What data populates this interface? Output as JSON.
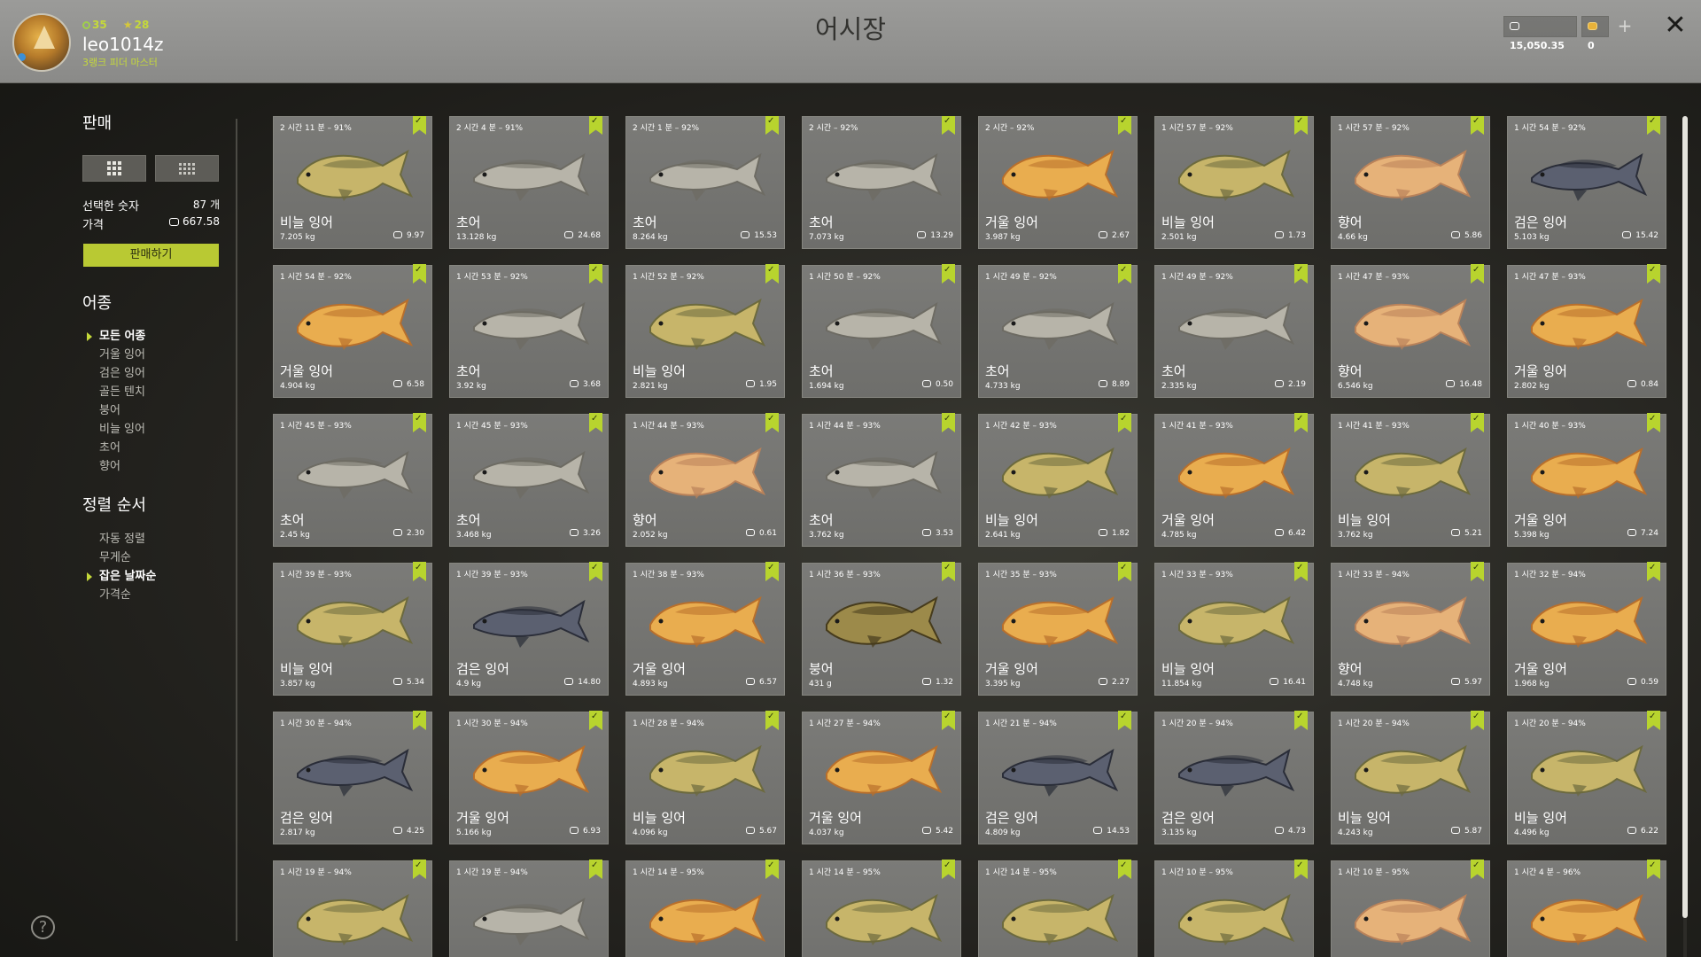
{
  "header": {
    "title": "어시장",
    "user": {
      "name": "leo1014z",
      "level": "35",
      "stars": "28",
      "rank": "3랭크 피더 마스터"
    },
    "silver": "15,050.35",
    "gold": "0",
    "plus_label": "+",
    "close_label": "✕"
  },
  "sidebar": {
    "sell_title": "판매",
    "selected_count_label": "선택한 숫자",
    "selected_count": "87 개",
    "price_label": "가격",
    "price_value": "667.58",
    "sell_button": "판매하기",
    "species_title": "어종",
    "species": [
      "모든 어종",
      "거울 잉어",
      "검은 잉어",
      "골든 텐치",
      "붕어",
      "비늘 잉어",
      "초어",
      "향어"
    ],
    "species_active": 0,
    "sort_title": "정렬 순서",
    "sort": [
      "자동 정렬",
      "무게순",
      "잡은 날짜순",
      "가격순"
    ],
    "sort_active": 2,
    "help_label": "?"
  },
  "colors": {
    "accent": "#b8d42e",
    "header_bg": "#929290",
    "card_bg": "#767673"
  },
  "fish_colors": {
    "비늘 잉어": [
      "#c7b56a",
      "#6c6a3e"
    ],
    "초어": [
      "#b7b4a9",
      "#6d6b63"
    ],
    "거울 잉어": [
      "#e9ad4f",
      "#b86f2c"
    ],
    "향어": [
      "#e6b279",
      "#b9825a"
    ],
    "검은 잉어": [
      "#5b6070",
      "#2a2d38"
    ],
    "붕어": [
      "#9c8a4a",
      "#463b1c"
    ]
  },
  "catches": [
    {
      "time": "2 시간 11 분 – 91%",
      "name": "비늘 잉어",
      "weight": "7.205 kg",
      "price": "9.97"
    },
    {
      "time": "2 시간 4 분 – 91%",
      "name": "초어",
      "weight": "13.128 kg",
      "price": "24.68"
    },
    {
      "time": "2 시간 1 분 – 92%",
      "name": "초어",
      "weight": "8.264 kg",
      "price": "15.53"
    },
    {
      "time": "2 시간 – 92%",
      "name": "초어",
      "weight": "7.073 kg",
      "price": "13.29"
    },
    {
      "time": "2 시간 – 92%",
      "name": "거울 잉어",
      "weight": "3.987 kg",
      "price": "2.67"
    },
    {
      "time": "1 시간 57 분 – 92%",
      "name": "비늘 잉어",
      "weight": "2.501 kg",
      "price": "1.73"
    },
    {
      "time": "1 시간 57 분 – 92%",
      "name": "향어",
      "weight": "4.66 kg",
      "price": "5.86"
    },
    {
      "time": "1 시간 54 분 – 92%",
      "name": "검은 잉어",
      "weight": "5.103 kg",
      "price": "15.42"
    },
    {
      "time": "1 시간 54 분 – 92%",
      "name": "거울 잉어",
      "weight": "4.904 kg",
      "price": "6.58"
    },
    {
      "time": "1 시간 53 분 – 92%",
      "name": "초어",
      "weight": "3.92 kg",
      "price": "3.68"
    },
    {
      "time": "1 시간 52 분 – 92%",
      "name": "비늘 잉어",
      "weight": "2.821 kg",
      "price": "1.95"
    },
    {
      "time": "1 시간 50 분 – 92%",
      "name": "초어",
      "weight": "1.694 kg",
      "price": "0.50"
    },
    {
      "time": "1 시간 49 분 – 92%",
      "name": "초어",
      "weight": "4.733 kg",
      "price": "8.89"
    },
    {
      "time": "1 시간 49 분 – 92%",
      "name": "초어",
      "weight": "2.335 kg",
      "price": "2.19"
    },
    {
      "time": "1 시간 47 분 – 93%",
      "name": "향어",
      "weight": "6.546 kg",
      "price": "16.48"
    },
    {
      "time": "1 시간 47 분 – 93%",
      "name": "거울 잉어",
      "weight": "2.802 kg",
      "price": "0.84"
    },
    {
      "time": "1 시간 45 분 – 93%",
      "name": "초어",
      "weight": "2.45 kg",
      "price": "2.30"
    },
    {
      "time": "1 시간 45 분 – 93%",
      "name": "초어",
      "weight": "3.468 kg",
      "price": "3.26"
    },
    {
      "time": "1 시간 44 분 – 93%",
      "name": "향어",
      "weight": "2.052 kg",
      "price": "0.61"
    },
    {
      "time": "1 시간 44 분 – 93%",
      "name": "초어",
      "weight": "3.762 kg",
      "price": "3.53"
    },
    {
      "time": "1 시간 42 분 – 93%",
      "name": "비늘 잉어",
      "weight": "2.641 kg",
      "price": "1.82"
    },
    {
      "time": "1 시간 41 분 – 93%",
      "name": "거울 잉어",
      "weight": "4.785 kg",
      "price": "6.42"
    },
    {
      "time": "1 시간 41 분 – 93%",
      "name": "비늘 잉어",
      "weight": "3.762 kg",
      "price": "5.21"
    },
    {
      "time": "1 시간 40 분 – 93%",
      "name": "거울 잉어",
      "weight": "5.398 kg",
      "price": "7.24"
    },
    {
      "time": "1 시간 39 분 – 93%",
      "name": "비늘 잉어",
      "weight": "3.857 kg",
      "price": "5.34"
    },
    {
      "time": "1 시간 39 분 – 93%",
      "name": "검은 잉어",
      "weight": "4.9 kg",
      "price": "14.80"
    },
    {
      "time": "1 시간 38 분 – 93%",
      "name": "거울 잉어",
      "weight": "4.893 kg",
      "price": "6.57"
    },
    {
      "time": "1 시간 36 분 – 93%",
      "name": "붕어",
      "weight": "431 g",
      "price": "1.32"
    },
    {
      "time": "1 시간 35 분 – 93%",
      "name": "거울 잉어",
      "weight": "3.395 kg",
      "price": "2.27"
    },
    {
      "time": "1 시간 33 분 – 93%",
      "name": "비늘 잉어",
      "weight": "11.854 kg",
      "price": "16.41"
    },
    {
      "time": "1 시간 33 분 – 94%",
      "name": "향어",
      "weight": "4.748 kg",
      "price": "5.97"
    },
    {
      "time": "1 시간 32 분 – 94%",
      "name": "거울 잉어",
      "weight": "1.968 kg",
      "price": "0.59"
    },
    {
      "time": "1 시간 30 분 – 94%",
      "name": "검은 잉어",
      "weight": "2.817 kg",
      "price": "4.25"
    },
    {
      "time": "1 시간 30 분 – 94%",
      "name": "거울 잉어",
      "weight": "5.166 kg",
      "price": "6.93"
    },
    {
      "time": "1 시간 28 분 – 94%",
      "name": "비늘 잉어",
      "weight": "4.096 kg",
      "price": "5.67"
    },
    {
      "time": "1 시간 27 분 – 94%",
      "name": "거울 잉어",
      "weight": "4.037 kg",
      "price": "5.42"
    },
    {
      "time": "1 시간 21 분 – 94%",
      "name": "검은 잉어",
      "weight": "4.809 kg",
      "price": "14.53"
    },
    {
      "time": "1 시간 20 분 – 94%",
      "name": "검은 잉어",
      "weight": "3.135 kg",
      "price": "4.73"
    },
    {
      "time": "1 시간 20 분 – 94%",
      "name": "비늘 잉어",
      "weight": "4.243 kg",
      "price": "5.87"
    },
    {
      "time": "1 시간 20 분 – 94%",
      "name": "비늘 잉어",
      "weight": "4.496 kg",
      "price": "6.22"
    },
    {
      "time": "1 시간 19 분 – 94%",
      "name": "",
      "weight": "",
      "price": "",
      "fish": "비늘 잉어"
    },
    {
      "time": "1 시간 19 분 – 94%",
      "name": "",
      "weight": "",
      "price": "",
      "fish": "초어"
    },
    {
      "time": "1 시간 14 분 – 95%",
      "name": "",
      "weight": "",
      "price": "",
      "fish": "거울 잉어"
    },
    {
      "time": "1 시간 14 분 – 95%",
      "name": "",
      "weight": "",
      "price": "",
      "fish": "비늘 잉어"
    },
    {
      "time": "1 시간 14 분 – 95%",
      "name": "",
      "weight": "",
      "price": "",
      "fish": "비늘 잉어"
    },
    {
      "time": "1 시간 10 분 – 95%",
      "name": "",
      "weight": "",
      "price": "",
      "fish": "비늘 잉어"
    },
    {
      "time": "1 시간 10 분 – 95%",
      "name": "",
      "weight": "",
      "price": "",
      "fish": "향어"
    },
    {
      "time": "1 시간 4 분 – 96%",
      "name": "",
      "weight": "",
      "price": "",
      "fish": "거울 잉어"
    }
  ]
}
